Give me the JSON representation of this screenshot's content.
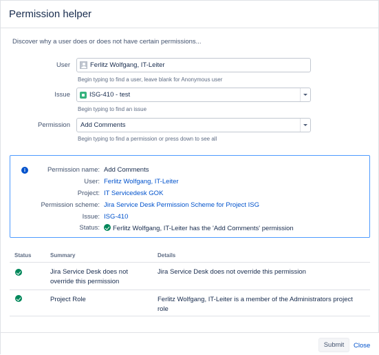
{
  "dialog": {
    "title": "Permission helper",
    "intro": "Discover why a user does or does not have certain permissions..."
  },
  "form": {
    "user": {
      "label": "User",
      "value": "Ferlitz Wolfgang, IT-Leiter",
      "help": "Begin typing to find a user, leave blank for Anonymous user",
      "icon": "user-avatar-icon"
    },
    "issue": {
      "label": "Issue",
      "value": "ISG-410 - test",
      "help": "Begin typing to find an issue",
      "icon": "issue-type-icon"
    },
    "permission": {
      "label": "Permission",
      "value": "Add Comments",
      "help": "Begin typing to find a permission or press down to see all"
    }
  },
  "result": {
    "icon": "info-icon",
    "rows": [
      {
        "key": "Permission name:",
        "value": "Add Comments",
        "link": false
      },
      {
        "key": "User:",
        "value": "Ferlitz Wolfgang, IT-Leiter",
        "link": true
      },
      {
        "key": "Project:",
        "value": "IT Servicedesk GOK",
        "link": true
      },
      {
        "key": "Permission scheme:",
        "value": "Jira Service Desk Permission Scheme for Project ISG",
        "link": true
      },
      {
        "key": "Issue:",
        "value": "ISG-410",
        "link": true
      }
    ],
    "status_key": "Status:",
    "status_value": "Ferlitz Wolfgang, IT-Leiter has the 'Add Comments' permission"
  },
  "table": {
    "headers": {
      "status": "Status",
      "summary": "Summary",
      "details": "Details"
    },
    "rows": [
      {
        "status_icon": "success-check-icon",
        "summary_line1": "Jira Service Desk does not",
        "summary_line2": "override this permission",
        "details_line1": "Jira Service Desk does not override this permission",
        "details_line2": ""
      },
      {
        "status_icon": "success-check-icon",
        "summary_line1": "Project Role",
        "summary_line2": "",
        "details_line1": "Ferlitz Wolfgang, IT-Leiter is a member of the Administrators project",
        "details_line2": "role"
      }
    ]
  },
  "footer": {
    "submit_label": "Submit",
    "close_label": "Close"
  },
  "colors": {
    "link": "#0052cc",
    "info_border": "#4c9aff",
    "success": "#00875a",
    "issue_icon": "#36b37e"
  }
}
